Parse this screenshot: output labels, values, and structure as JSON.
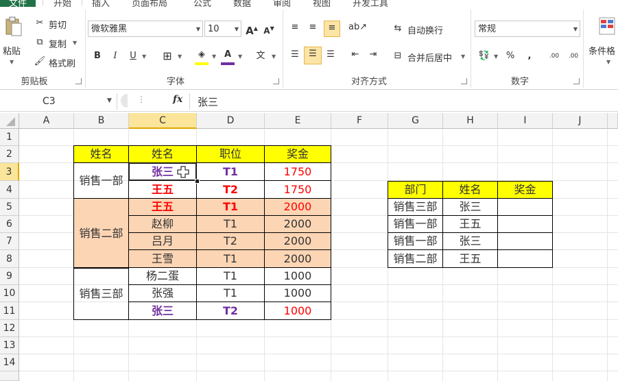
{
  "ribbon": {
    "tabs": [
      "文件",
      "开始",
      "插入",
      "页面布局",
      "公式",
      "数据",
      "审阅",
      "视图",
      "开发工具"
    ],
    "clipboard": {
      "paste": "粘贴",
      "cut": "剪切",
      "copy": "复制",
      "format_painter": "格式刷",
      "group": "剪贴板"
    },
    "font": {
      "name": "微软雅黑",
      "size": "10",
      "group": "字体",
      "grow": "A",
      "shrink": "A"
    },
    "alignment": {
      "wrap": "自动换行",
      "merge": "合并后居中",
      "group": "对齐方式"
    },
    "number": {
      "format": "常规",
      "group": "数字",
      "percent": "%",
      "comma": ",",
      "inc_decimal": ".00",
      "dec_decimal": ".00"
    },
    "styles": {
      "conditional": "条件格"
    },
    "colors": {
      "fill_accent": "#ffff00",
      "font_accent": "#7030a0"
    }
  },
  "formula_bar": {
    "name_box": "C3",
    "fx": "fx",
    "value": "张三"
  },
  "columns": [
    "A",
    "B",
    "C",
    "D",
    "E",
    "F",
    "G",
    "H",
    "I",
    "J"
  ],
  "rows": [
    "1",
    "2",
    "3",
    "4",
    "5",
    "6",
    "7",
    "8",
    "9",
    "10",
    "11",
    "12",
    "13",
    "14"
  ],
  "table1": {
    "headers": [
      "姓名",
      "姓名",
      "职位",
      "奖金"
    ],
    "groups": [
      "销售一部",
      "销售二部",
      "销售三部"
    ],
    "rows": [
      [
        "张三",
        "T1",
        "1750"
      ],
      [
        "王五",
        "T2",
        "1750"
      ],
      [
        "王五",
        "T1",
        "2000"
      ],
      [
        "赵柳",
        "T1",
        "2000"
      ],
      [
        "吕月",
        "T2",
        "2000"
      ],
      [
        "王雪",
        "T1",
        "2000"
      ],
      [
        "杨二蛋",
        "T1",
        "1000"
      ],
      [
        "张强",
        "T1",
        "1000"
      ],
      [
        "张三",
        "T2",
        "1000"
      ]
    ]
  },
  "table2": {
    "headers": [
      "部门",
      "姓名",
      "奖金"
    ],
    "rows": [
      [
        "销售三部",
        "张三",
        ""
      ],
      [
        "销售一部",
        "王五",
        ""
      ],
      [
        "销售一部",
        "张三",
        ""
      ],
      [
        "销售二部",
        "王五",
        ""
      ]
    ]
  }
}
